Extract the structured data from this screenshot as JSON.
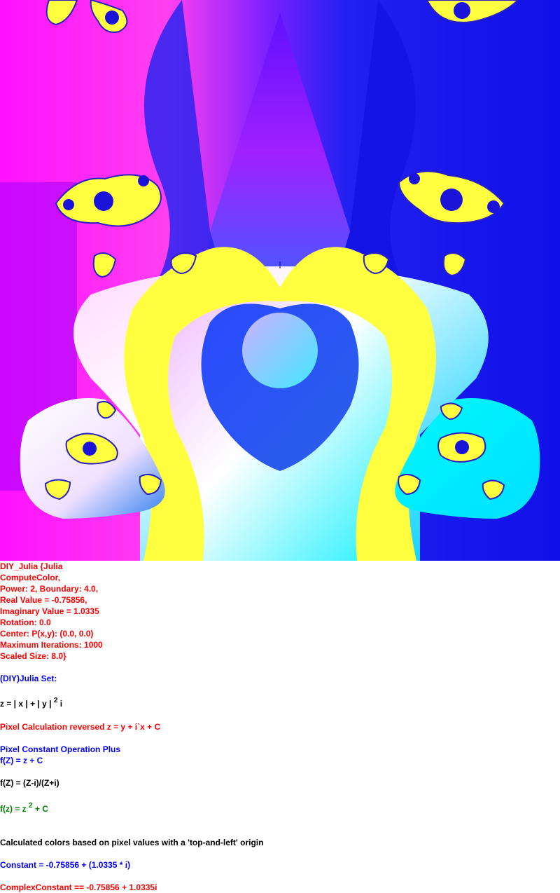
{
  "colors": {
    "yellow": "#ffff40",
    "magenta": "#ff00ff",
    "blue": "#1010ee",
    "violet": "#8000ff",
    "cyan": "#00ffff",
    "white": "#ffffff",
    "text_red": "#ff0000",
    "text_blue": "#0000ff",
    "text_black": "#000000",
    "text_green": "#008000"
  },
  "params": [
    "DIY_Julia {Julia",
    "ComputeColor,",
    "Power: 2, Boundary: 4.0,",
    "Real Value = -0.75856,",
    "Imaginary Value = 1.0335",
    "Rotation: 0.0",
    "Center: P(x,y): (0.0, 0.0)",
    "Maximum Iterations: 1000",
    "Scaled Size: 8.0}"
  ],
  "title": "(DIY)Julia Set:",
  "z_formula": {
    "base": "z = | x | + | y | ",
    "exp": "2",
    "suffix": " i"
  },
  "pixel_calc": "Pixel Calculation reversed z = y + i`x + C",
  "pixel_const": "Pixel Constant Operation Plus",
  "f1": "f(Z) = z + C",
  "f2": "f(Z) = (Z-i)/(Z+i)",
  "f3": {
    "base": "f(z) = z ",
    "exp": "2",
    "suffix": " + C"
  },
  "origin_note": "Calculated colors based on pixel values with a 'top-and-left' origin",
  "constant": "Constant = -0.75856 + (1.0335 * i)",
  "complex_constant": "ComplexConstant == -0.75856 + 1.0335i"
}
